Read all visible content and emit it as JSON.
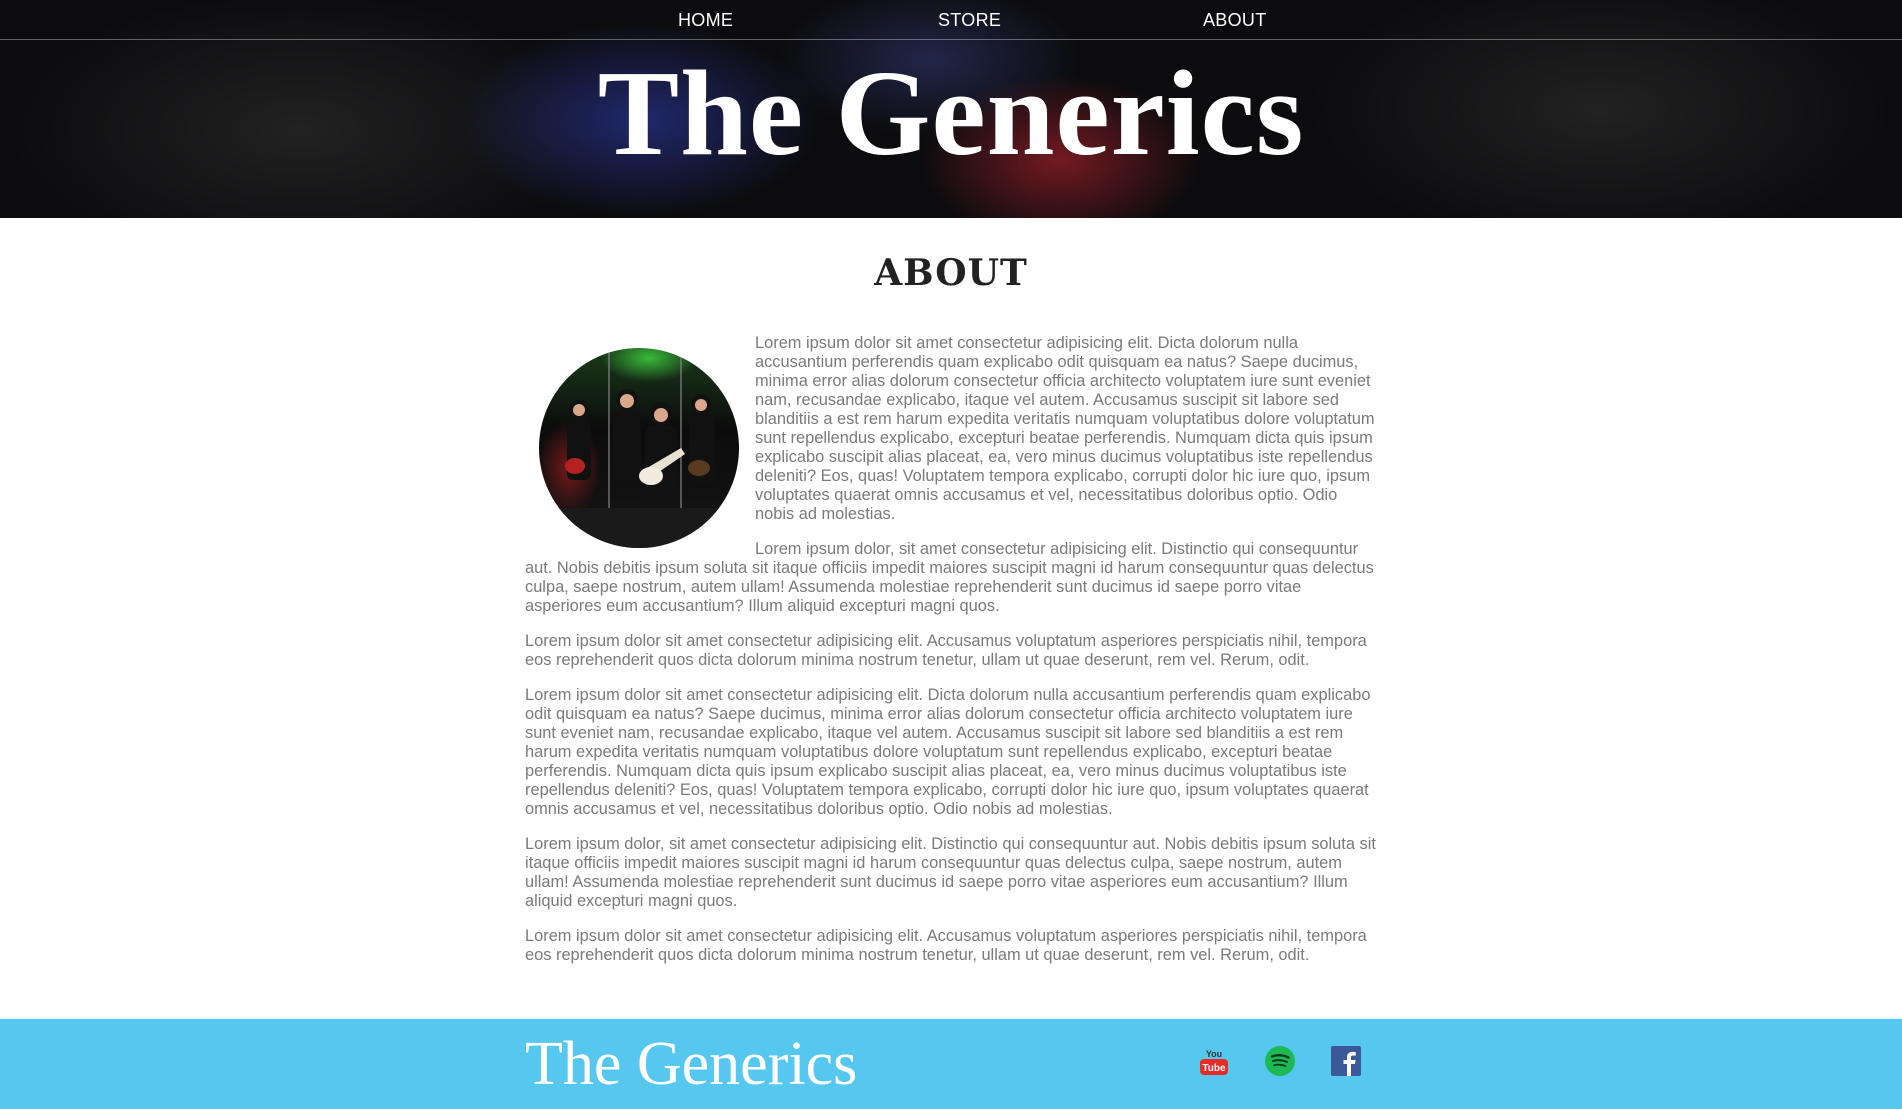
{
  "nav": {
    "home": "HOME",
    "store": "STORE",
    "about": "ABOUT"
  },
  "header": {
    "title": "The Generics"
  },
  "main": {
    "section_title": "ABOUT",
    "paragraphs": [
      "Lorem ipsum dolor sit amet consectetur adipisicing elit. Dicta dolorum nulla accusantium perferendis quam explicabo odit quisquam ea natus? Saepe ducimus, minima error alias dolorum consectetur officia architecto voluptatem iure sunt eveniet nam, recusandae explicabo, itaque vel autem. Accusamus suscipit sit labore sed blanditiis a est rem harum expedita veritatis numquam voluptatibus dolore voluptatum sunt repellendus explicabo, excepturi beatae perferendis. Numquam dicta quis ipsum explicabo suscipit alias placeat, ea, vero minus ducimus voluptatibus iste repellendus deleniti? Eos, quas! Voluptatem tempora explicabo, corrupti dolor hic iure quo, ipsum voluptates quaerat omnis accusamus et vel, necessitatibus doloribus optio. Odio nobis ad molestias.",
      "Lorem ipsum dolor, sit amet consectetur adipisicing elit. Distinctio qui consequuntur aut. Nobis debitis ipsum soluta sit itaque officiis impedit maiores suscipit magni id harum consequuntur quas delectus culpa, saepe nostrum, autem ullam! Assumenda molestiae reprehenderit sunt ducimus id saepe porro vitae asperiores eum accusantium? Illum aliquid excepturi magni quos.",
      "Lorem ipsum dolor sit amet consectetur adipisicing elit. Accusamus voluptatum asperiores perspiciatis nihil, tempora eos reprehenderit quos dicta dolorum minima nostrum tenetur, ullam ut quae deserunt, rem vel. Rerum, odit.",
      "Lorem ipsum dolor sit amet consectetur adipisicing elit. Dicta dolorum nulla accusantium perferendis quam explicabo odit quisquam ea natus? Saepe ducimus, minima error alias dolorum consectetur officia architecto voluptatem iure sunt eveniet nam, recusandae explicabo, itaque vel autem. Accusamus suscipit sit labore sed blanditiis a est rem harum expedita veritatis numquam voluptatibus dolore voluptatum sunt repellendus explicabo, excepturi beatae perferendis. Numquam dicta quis ipsum explicabo suscipit alias placeat, ea, vero minus ducimus voluptatibus iste repellendus deleniti? Eos, quas! Voluptatem tempora explicabo, corrupti dolor hic iure quo, ipsum voluptates quaerat omnis accusamus et vel, necessitatibus doloribus optio. Odio nobis ad molestias.",
      "Lorem ipsum dolor, sit amet consectetur adipisicing elit. Distinctio qui consequuntur aut. Nobis debitis ipsum soluta sit itaque officiis impedit maiores suscipit magni id harum consequuntur quas delectus culpa, saepe nostrum, autem ullam! Assumenda molestiae reprehenderit sunt ducimus id saepe porro vitae asperiores eum accusantium? Illum aliquid excepturi magni quos.",
      "Lorem ipsum dolor sit amet consectetur adipisicing elit. Accusamus voluptatum asperiores perspiciatis nihil, tempora eos reprehenderit quos dicta dolorum minima nostrum tenetur, ullam ut quae deserunt, rem vel. Rerum, odit."
    ]
  },
  "footer": {
    "title": "The Generics",
    "social": [
      {
        "icon": "youtube-icon",
        "color": "#e52d27"
      },
      {
        "icon": "spotify-icon",
        "color": "#1db954"
      },
      {
        "icon": "facebook-icon",
        "color": "#3b5998"
      }
    ]
  },
  "colors": {
    "footer_bg": "#56c8f0",
    "header_bg": "#0c0c0e",
    "body_text": "#7a7a7a"
  }
}
